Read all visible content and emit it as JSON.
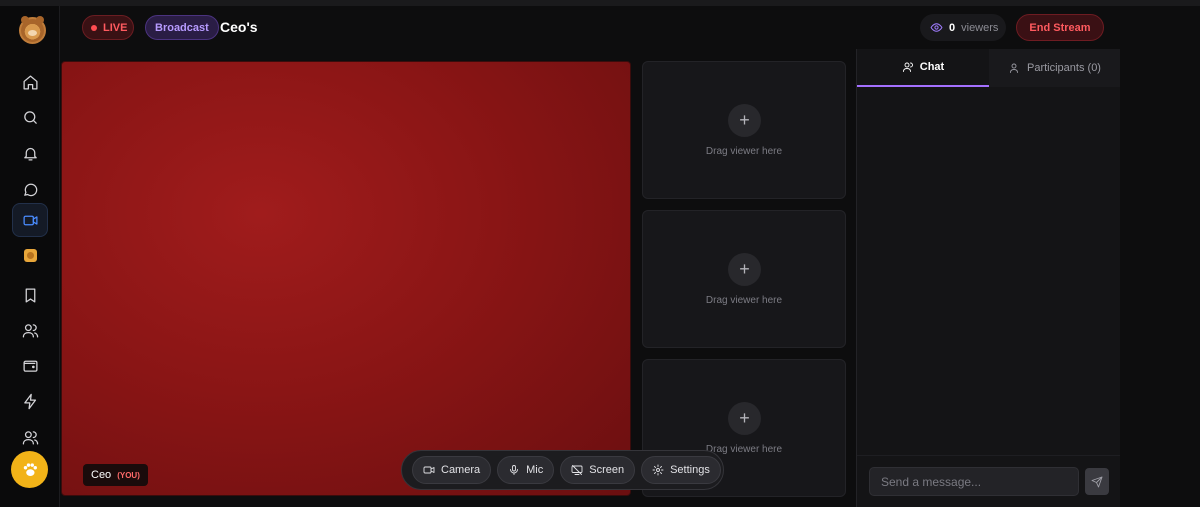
{
  "header": {
    "live_label": "LIVE",
    "broadcast_label": "Broadcast",
    "title": "Ceo's",
    "viewers_count": "0",
    "viewers_label": "viewers",
    "end_stream_label": "End Stream"
  },
  "sidebar": {
    "items": [
      {
        "icon": "home-icon"
      },
      {
        "icon": "search-icon"
      },
      {
        "icon": "bell-icon"
      },
      {
        "icon": "message-icon"
      },
      {
        "icon": "video-icon",
        "active": true
      },
      {
        "icon": "badge-icon"
      },
      {
        "icon": "bookmark-icon"
      },
      {
        "icon": "users-icon"
      },
      {
        "icon": "wallet-icon"
      },
      {
        "icon": "bolt-icon"
      },
      {
        "icon": "group-icon"
      }
    ]
  },
  "video": {
    "self_name": "Ceo",
    "self_tag": "(YOU)"
  },
  "slots": [
    {
      "label": "Drag viewer here"
    },
    {
      "label": "Drag viewer here"
    },
    {
      "label": "Drag viewer here"
    }
  ],
  "controls": {
    "camera": "Camera",
    "mic": "Mic",
    "screen": "Screen",
    "settings": "Settings"
  },
  "chat": {
    "tab_chat": "Chat",
    "tab_participants": "Participants (0)",
    "input_placeholder": "Send a message..."
  },
  "colors": {
    "live": "#ff5a5f",
    "accent_purple": "#a470ff",
    "active_nav": "#4a8cff",
    "fab": "#f2b318"
  }
}
